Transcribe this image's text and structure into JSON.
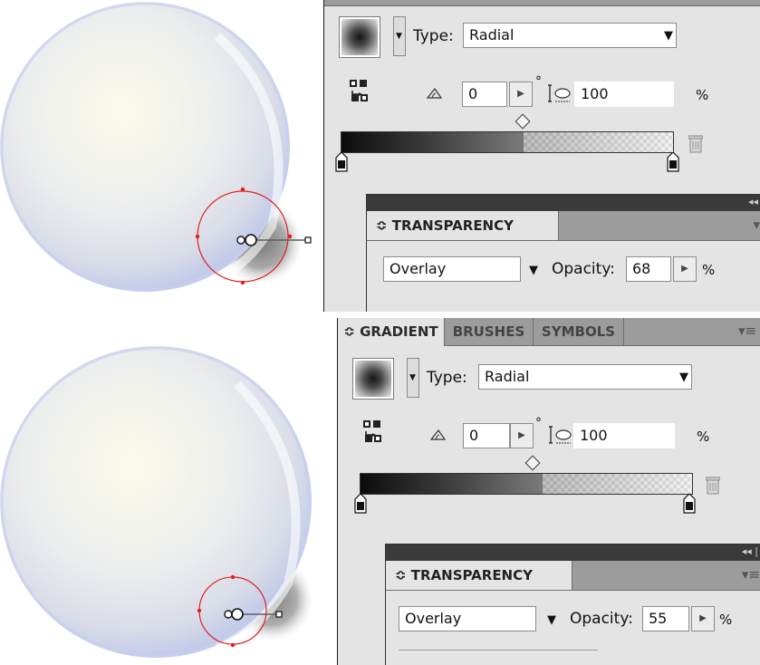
{
  "icons": {
    "swatch": "gradient-swatch-icon",
    "reverse": "reverse-gradient-icon",
    "angle": "angle-icon",
    "aspect": "aspect-ratio-icon",
    "trash": "trash-icon",
    "menu": "panel-menu-icon",
    "collapse": "collapse-panel-icon"
  },
  "step1": {
    "gradient": {
      "type_label": "Type:",
      "type_value": "Radial",
      "angle_value": "0",
      "degree_symbol": "°",
      "aspect_value": "100",
      "percent_symbol": "%"
    },
    "transparency": {
      "tab_label": "≎ TRANSPARENCY",
      "blend_mode": "Overlay",
      "opacity_label": "Opacity:",
      "opacity_value": "68",
      "percent_symbol": "%"
    }
  },
  "step2": {
    "tabs": [
      "≎ GRADIENT",
      "BRUSHES",
      "SYMBOLS"
    ],
    "gradient": {
      "type_label": "Type:",
      "type_value": "Radial",
      "angle_value": "0",
      "degree_symbol": "°",
      "aspect_value": "100",
      "percent_symbol": "%"
    },
    "transparency": {
      "tab_label": "≎ TRANSPARENCY",
      "blend_mode": "Overlay",
      "opacity_label": "Opacity:",
      "opacity_value": "55",
      "percent_symbol": "%"
    }
  },
  "colors": {
    "panel_bg": "#e4e4e4",
    "tab_bar": "#9c9c9c",
    "handle_circle": "#e02020",
    "bubble_tint": "#b8c4ec"
  }
}
